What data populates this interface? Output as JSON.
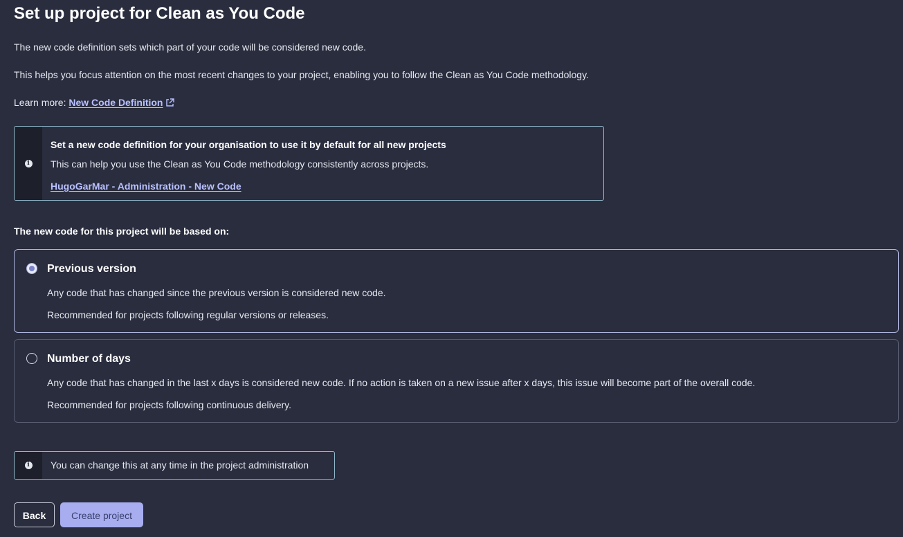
{
  "title": "Set up project for Clean as You Code",
  "intro": {
    "line1": "The new code definition sets which part of your code will be considered new code.",
    "line2": "This helps you focus attention on the most recent changes to your project, enabling you to follow the Clean as You Code methodology.",
    "learn_more_prefix": "Learn more:",
    "learn_more_link": "New Code Definition",
    "learn_more_icon": "external-link-icon"
  },
  "org_info": {
    "icon": "info-icon",
    "heading": "Set a new code definition for your organisation to use it by default for all new projects",
    "body": "This can help you use the Clean as You Code methodology consistently across projects.",
    "link": "HugoGarMar - Administration - New Code"
  },
  "section_label": "The new code for this project will be based on:",
  "options": [
    {
      "title": "Previous version",
      "selected": true,
      "desc1": "Any code that has changed since the previous version is considered new code.",
      "desc2": "Recommended for projects following regular versions or releases."
    },
    {
      "title": "Number of days",
      "selected": false,
      "desc1": "Any code that has changed in the last x days is considered new code. If no action is taken on a new issue after x days, this issue will become part of the overall code.",
      "desc2": "Recommended for projects following continuous delivery."
    }
  ],
  "note": {
    "icon": "info-icon",
    "text": "You can change this at any time in the project administration"
  },
  "buttons": {
    "back": "Back",
    "create": "Create project"
  },
  "colors": {
    "background": "#2a2d3e",
    "link": "#b8c0ff",
    "info_border": "#8fb7c9",
    "primary_button": "#a7adef"
  }
}
